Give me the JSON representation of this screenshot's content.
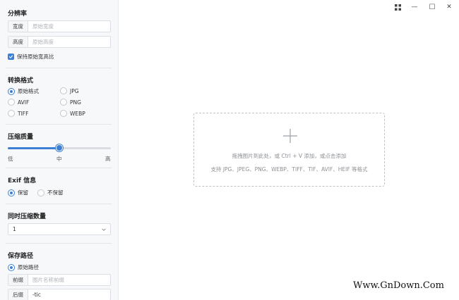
{
  "sidebar": {
    "resolution": {
      "title": "分辨率",
      "width_label": "宽度",
      "width_placeholder": "原始宽度",
      "height_label": "高度",
      "height_placeholder": "原始高度",
      "keep_ratio_label": "保持原始宽高比",
      "keep_ratio_checked": true
    },
    "format": {
      "title": "转换格式",
      "options": [
        {
          "label": "原始格式",
          "selected": true
        },
        {
          "label": "JPG",
          "selected": false
        },
        {
          "label": "AVIF",
          "selected": false
        },
        {
          "label": "PNG",
          "selected": false
        },
        {
          "label": "TIFF",
          "selected": false
        },
        {
          "label": "WEBP",
          "selected": false
        }
      ]
    },
    "quality": {
      "title": "压缩质量",
      "value_fraction": 0.5,
      "low_label": "低",
      "mid_label": "中",
      "high_label": "高"
    },
    "exif": {
      "title": "Exif 信息",
      "options": [
        {
          "label": "保留",
          "selected": true
        },
        {
          "label": "不保留",
          "selected": false
        }
      ]
    },
    "concurrency": {
      "title": "同时压缩数量",
      "value": "1"
    },
    "save_path": {
      "title": "保存路径",
      "option_label": "原始路径",
      "option_selected": true,
      "prefix_label": "前缀",
      "prefix_placeholder": "图片名称前缀",
      "suffix_label": "后缀",
      "suffix_value": "-tic"
    }
  },
  "dropzone": {
    "line1": "拖拽图片到此处，或 Ctrl + V 添加，或点击添加",
    "line2": "支持 JPG、JPEG、PNG、WEBP、TIFF、TIF、AVIF、HEIF 等格式"
  },
  "window_controls": {
    "grid_icon": "grid-icon",
    "minimize_glyph": "—",
    "maximize_glyph": "☐",
    "close_glyph": "✕"
  },
  "watermark": "Www.GnDown.Com",
  "colors": {
    "accent": "#3c7fd6",
    "sidebar_bg": "#f7f8fa"
  }
}
